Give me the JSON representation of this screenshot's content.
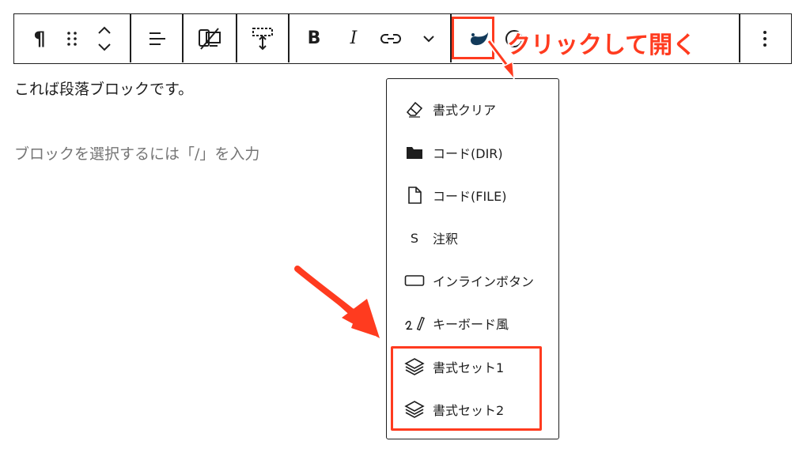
{
  "toolbar": {
    "paragraph_icon_glyph": "¶",
    "bold_label": "B",
    "italic_label": "I"
  },
  "editor": {
    "paragraph_text": "これば段落ブロックです。",
    "placeholder": "ブロックを選択するには「/」を入力"
  },
  "annotation": {
    "callout_text": "クリックして開く",
    "highlight_color": "#ff3b1f"
  },
  "dropdown": {
    "items": [
      {
        "label": "書式クリア",
        "icon": "eraser-icon"
      },
      {
        "label": "コード(DIR)",
        "icon": "folder-icon"
      },
      {
        "label": "コード(FILE)",
        "icon": "file-icon"
      },
      {
        "label": "注釈",
        "icon": "s-letter-icon",
        "glyph": "S"
      },
      {
        "label": "インラインボタン",
        "icon": "button-outline-icon"
      },
      {
        "label": "キーボード風",
        "icon": "keyboard-pen-icon"
      },
      {
        "label": "書式セット1",
        "icon": "layers-icon"
      },
      {
        "label": "書式セット2",
        "icon": "layers-icon"
      }
    ]
  }
}
